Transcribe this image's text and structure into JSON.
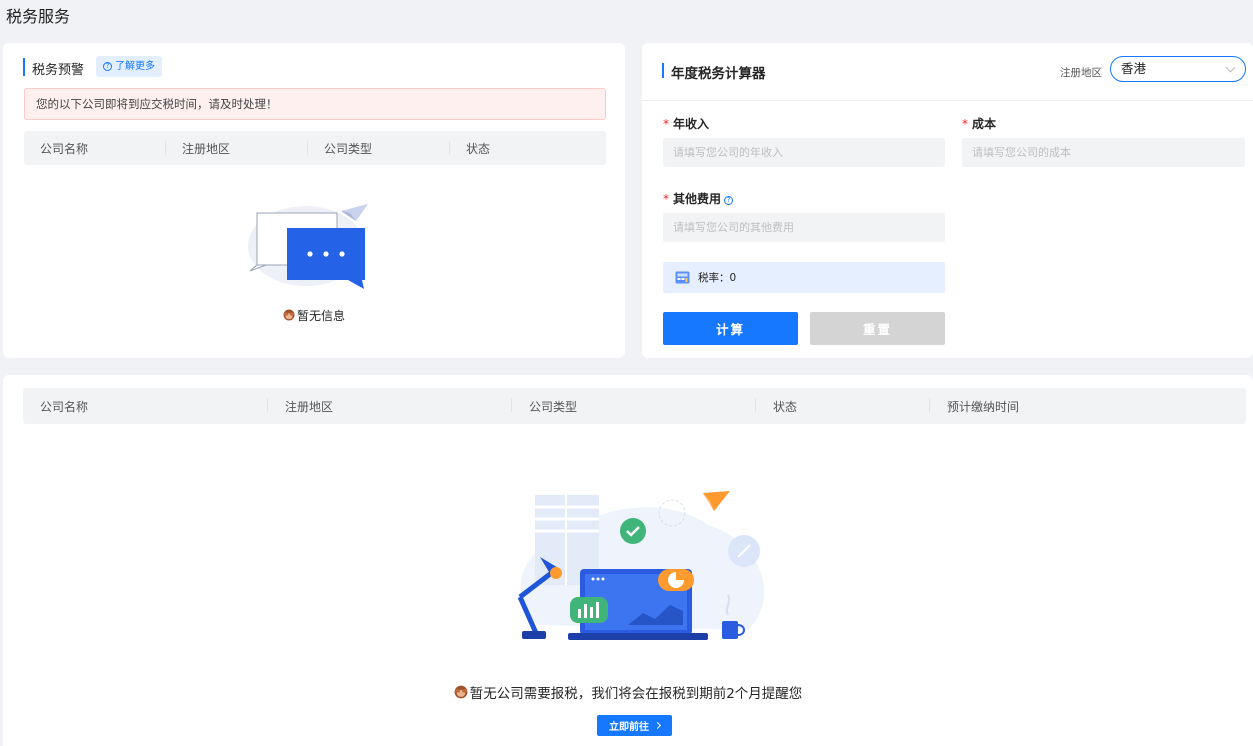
{
  "page": {
    "title": "税务服务"
  },
  "warning": {
    "title": "税务预警",
    "learn_more": "了解更多",
    "alert": "您的以下公司即将到应交税时间，请及时处理！",
    "columns": [
      "公司名称",
      "注册地区",
      "公司类型",
      "状态"
    ],
    "empty_text": "暂无信息"
  },
  "calculator": {
    "title": "年度税务计算器",
    "region_label": "注册地区",
    "region_value": "香港",
    "fields": {
      "income": {
        "label": "年收入",
        "placeholder": "请填写您公司的年收入"
      },
      "cost": {
        "label": "成本",
        "placeholder": "请填写您公司的成本"
      },
      "other": {
        "label": "其他费用",
        "placeholder": "请填写您公司的其他费用"
      }
    },
    "rate_label": "税率：",
    "rate_value": "0",
    "calc_button": "计算",
    "reset_button": "重置"
  },
  "list": {
    "columns": [
      "公司名称",
      "注册地区",
      "公司类型",
      "状态",
      "预计缴纳时间"
    ],
    "empty_text": "暂无公司需要报税，我们将会在报税到期前2个月提醒您",
    "go_button": "立即前往"
  },
  "colors": {
    "primary": "#1677ff",
    "alert_bg": "#fff0f0",
    "required": "#f5222d"
  }
}
